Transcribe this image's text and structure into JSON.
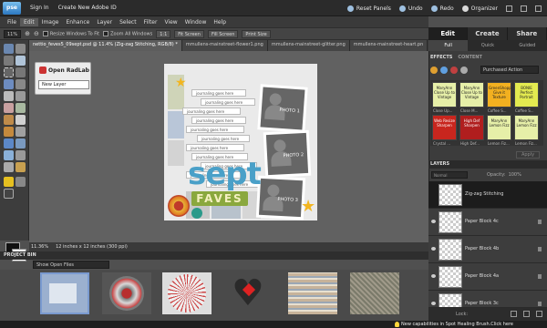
{
  "app": {
    "logo": "pse",
    "topbar": {
      "signin": "Sign In",
      "create_id": "Create New Adobe ID",
      "reset": "Reset Panels",
      "undo": "Undo",
      "redo": "Redo",
      "organizer": "Organizer"
    }
  },
  "menu": [
    "File",
    "Edit",
    "Image",
    "Enhance",
    "Layer",
    "Select",
    "Filter",
    "View",
    "Window",
    "Help"
  ],
  "options": {
    "zoom": "11%",
    "resize_windows": "Resize Windows To Fit",
    "zoom_all": "Zoom All Windows",
    "one_to_one": "1:1",
    "fit_screen": "Fit Screen",
    "fill_screen": "Fill Screen",
    "print_size": "Print Size"
  },
  "doc_tabs": [
    "nettio_feves5_09sept.psd @ 11.4% (Zig-zag Stitching, RGB/8) *",
    "mmullens-mainstreet-flower1.png",
    "mmullens-mainstreet-glitter.png",
    "mmullens-mainstreet-heart.pn"
  ],
  "radlab": {
    "title": "Open RadLab",
    "selected": "New Layer"
  },
  "canvas": {
    "journal_strips": [
      "journaling goes here",
      "journaling goes here",
      "journaling goes here",
      "journaling goes here",
      "journaling goes here",
      "journaling goes here",
      "journaling goes here",
      "journaling goes here",
      "journaling goes here",
      "journaling goes here",
      "journaling goes here"
    ],
    "photos": [
      "PHOTO 1",
      "PHOTO 2",
      "PHOTO 3"
    ],
    "title_big": "sept",
    "title_small": "FAVES"
  },
  "status": {
    "zoom": "11.36%",
    "size": "12 inches x 12 inches (300 ppi)"
  },
  "project_bin": {
    "header": "PROJECT BIN",
    "selected": "Show Open Files"
  },
  "right_panel": {
    "tabs": [
      "Edit",
      "Create",
      "Share"
    ],
    "subtabs": [
      "Full",
      "Quick",
      "Guided"
    ],
    "effects_label": "EFFECTS",
    "content_label": "CONTENT",
    "effects_select": "Purchased Action",
    "effects": [
      {
        "text": "MaryAnn Close Up to Vintage",
        "caption": "Close Up..."
      },
      {
        "text": "MaryAnn Close Up to Vintage",
        "caption": "Close M..."
      },
      {
        "text": "GreenShopp Give it Texture",
        "caption": "Coffee S..."
      },
      {
        "text": "BONIE Perfect Portrait",
        "caption": "Coffee S..."
      },
      {
        "text": "Web Resize Sharpen",
        "caption": "Crystal ..."
      },
      {
        "text": "High Def Sharpen",
        "caption": "High Def..."
      },
      {
        "text": "MaryAnn Lemon Fizz",
        "caption": "Lemon Fiz..."
      },
      {
        "text": "MaryAnn Lemon Fizz",
        "caption": "Lemon Fiz..."
      }
    ],
    "apply": "Apply",
    "layers_label": "LAYERS",
    "blend_mode": "Normal",
    "opacity_label": "Opacity:",
    "opacity_value": "100%",
    "lock_label": "Lock:",
    "layers": [
      "Zig-zag Stitching",
      "Paper Block 4c",
      "Paper Block 4b",
      "Paper Block 4a",
      "Paper Block 3c"
    ]
  },
  "bottom_status": "New capabilities in Spot Healing Brush.Click here"
}
